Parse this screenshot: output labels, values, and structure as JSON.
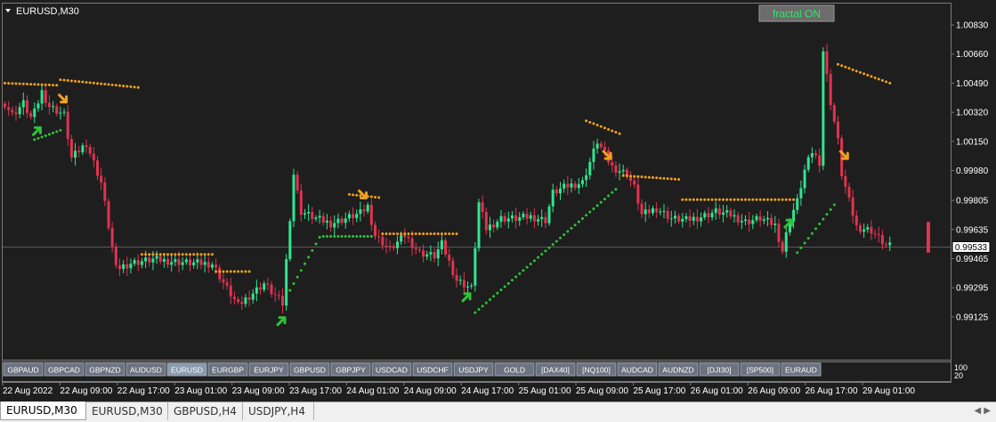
{
  "window": {
    "symbol_title": "EURUSD,M30",
    "fractal_label": "fractal ON",
    "current_price": "0.99533",
    "indicator_scale_top": "100",
    "indicator_scale_bottom": "20"
  },
  "colors": {
    "background": "#1e1e1e",
    "bull": "#2fe58f",
    "bear": "#e0334f",
    "sar_orange": "#f0a020",
    "sar_green": "#2ec33a",
    "grid_text": "#ffffff",
    "fractal_badge": "#6c6c6c",
    "fractal_text": "#36e36b"
  },
  "symbol_buttons": [
    "GBPAUD",
    "GBPCAD",
    "GBPNZD",
    "AUDUSD",
    "EURUSD",
    "EURGBP",
    "EURJPY",
    "GBPUSD",
    "GBPJPY",
    "USDCAD",
    "USDCHF",
    "USDJPY",
    "GOLD",
    "[DAX40]",
    "[NQ100]",
    "AUDCAD",
    "AUDNZD",
    "[DJI30]",
    "[SP500]",
    "EURAUD"
  ],
  "active_symbol": "EURUSD",
  "tabs": [
    {
      "label": "EURUSD,M30",
      "active": true
    },
    {
      "label": "EURUSD,M30",
      "active": false
    },
    {
      "label": "GBPUSD,H4",
      "active": false
    },
    {
      "label": "USDJPY,H4",
      "active": false
    }
  ],
  "chart_data": {
    "type": "candlestick",
    "ylim": [
      0.98875,
      1.00955
    ],
    "y_ticks": [
      "1.00830",
      "1.00660",
      "1.00490",
      "1.00320",
      "1.00150",
      "0.99980",
      "0.99805",
      "0.99635",
      "0.99465",
      "0.99295",
      "0.99125"
    ],
    "x_ticks": [
      "22 Aug 2022",
      "22 Aug 09:00",
      "22 Aug 17:00",
      "23 Aug 01:00",
      "23 Aug 09:00",
      "23 Aug 17:00",
      "24 Aug 01:00",
      "24 Aug 09:00",
      "24 Aug 17:00",
      "25 Aug 01:00",
      "25 Aug 09:00",
      "25 Aug 17:00",
      "26 Aug 01:00",
      "26 Aug 09:00",
      "26 Aug 17:00",
      "29 Aug 01:00"
    ],
    "last_price": 0.99533,
    "anchors": [
      [
        0,
        1.00372
      ],
      [
        2,
        1.00305
      ],
      [
        5,
        1.00372
      ],
      [
        7,
        1.00288
      ],
      [
        8,
        1.0032
      ],
      [
        10,
        1.0044
      ],
      [
        12,
        1.00355
      ],
      [
        16,
        1.00305
      ],
      [
        18,
        1.0005
      ],
      [
        22,
        1.0014
      ],
      [
        26,
        0.9991
      ],
      [
        30,
        0.99405
      ],
      [
        34,
        0.9944
      ],
      [
        40,
        0.9946
      ],
      [
        50,
        0.9944
      ],
      [
        56,
        0.99435
      ],
      [
        60,
        0.9929
      ],
      [
        63,
        0.9919
      ],
      [
        65,
        0.9923
      ],
      [
        70,
        0.9932
      ],
      [
        75,
        0.992
      ],
      [
        78,
        0.9996
      ],
      [
        80,
        0.9974
      ],
      [
        84,
        0.997
      ],
      [
        88,
        0.9967
      ],
      [
        92,
        0.997
      ],
      [
        96,
        0.9973
      ],
      [
        98,
        0.9977
      ],
      [
        100,
        0.996
      ],
      [
        104,
        0.9952
      ],
      [
        108,
        0.996
      ],
      [
        112,
        0.995
      ],
      [
        116,
        0.9948
      ],
      [
        118,
        0.9955
      ],
      [
        122,
        0.9934
      ],
      [
        126,
        0.9929
      ],
      [
        128,
        0.9979
      ],
      [
        130,
        0.9964
      ],
      [
        134,
        0.997
      ],
      [
        138,
        0.997
      ],
      [
        142,
        0.9971
      ],
      [
        146,
        0.9969
      ],
      [
        148,
        0.9985
      ],
      [
        152,
        0.9989
      ],
      [
        156,
        0.9991
      ],
      [
        160,
        1.0015
      ],
      [
        164,
        1.0
      ],
      [
        168,
        0.9996
      ],
      [
        170,
        0.9988
      ],
      [
        172,
        0.9972
      ],
      [
        176,
        0.9976
      ],
      [
        180,
        0.997
      ],
      [
        184,
        0.9969
      ],
      [
        188,
        0.9971
      ],
      [
        192,
        0.9974
      ],
      [
        196,
        0.9972
      ],
      [
        200,
        0.9968
      ],
      [
        204,
        0.997
      ],
      [
        208,
        0.9966
      ],
      [
        210,
        0.9951
      ],
      [
        212,
        0.997
      ],
      [
        214,
        0.998
      ],
      [
        216,
        0.9998
      ],
      [
        218,
        1.0009
      ],
      [
        220,
        1.0003
      ],
      [
        221,
        1.0068
      ],
      [
        223,
        1.0038
      ],
      [
        225,
        1.0015
      ],
      [
        226,
        0.9996
      ],
      [
        228,
        0.998
      ],
      [
        230,
        0.9965
      ],
      [
        234,
        0.9963
      ],
      [
        238,
        0.9954
      ]
    ],
    "orange_sar": [
      [
        0,
        14,
        1.0049,
        -0.00012
      ],
      [
        15,
        36,
        1.0051,
        -0.00045
      ],
      [
        37,
        56,
        0.9949,
        0
      ],
      [
        57,
        66,
        0.9939,
        0
      ],
      [
        93,
        101,
        0.9984,
        -0.00018
      ],
      [
        102,
        122,
        0.9961,
        0
      ],
      [
        157,
        166,
        1.0027,
        -0.00075
      ],
      [
        167,
        182,
        0.9995,
        -0.00022
      ],
      [
        183,
        213,
        0.9981,
        0
      ],
      [
        225,
        239,
        1.006,
        -0.0011
      ]
    ],
    "green_sar": [
      [
        8,
        15,
        1.0016,
        0.00055
      ],
      [
        77,
        85,
        0.9928,
        0.0031
      ],
      [
        86,
        99,
        0.99595,
        0
      ],
      [
        127,
        165,
        0.9915,
        0.0072
      ],
      [
        214,
        224,
        0.995,
        0.0028
      ]
    ],
    "arrows": [
      {
        "dir": "up",
        "i": 9,
        "p": 1.0022
      },
      {
        "dir": "down",
        "i": 16,
        "p": 1.0039
      },
      {
        "dir": "up",
        "i": 75,
        "p": 0.9911
      },
      {
        "dir": "down",
        "i": 97,
        "p": 0.9983
      },
      {
        "dir": "up",
        "i": 125,
        "p": 0.9925
      },
      {
        "dir": "down",
        "i": 163,
        "p": 1.0006
      },
      {
        "dir": "up",
        "i": 212,
        "p": 0.9968
      },
      {
        "dir": "down",
        "i": 227,
        "p": 1.0006
      }
    ]
  }
}
